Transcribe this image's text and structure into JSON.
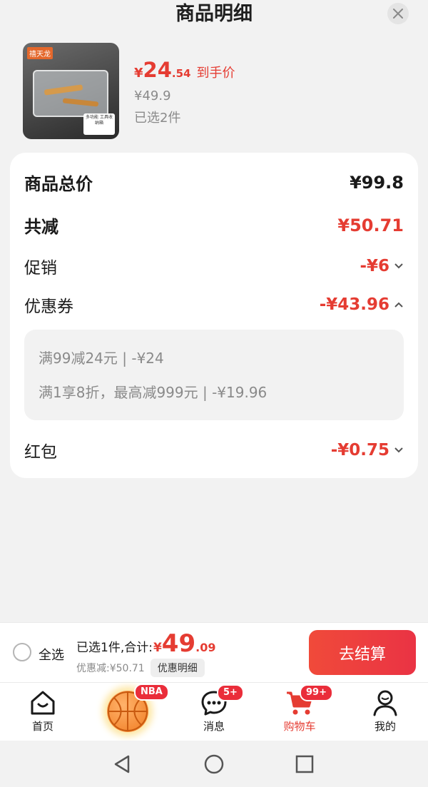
{
  "header": {
    "title": "商品明细"
  },
  "product": {
    "brand_logo": "禧天龙",
    "box_tag": "多功能 工具收纳箱",
    "price_symbol": "¥",
    "price_int": "24",
    "price_dec": ".54",
    "price_label": "到手价",
    "original_price": "¥49.9",
    "selected_count": "已选2件"
  },
  "details": {
    "total_label": "商品总价",
    "total_value": "¥99.8",
    "reduce_label": "共减",
    "reduce_value": "¥50.71",
    "promo_label": "促销",
    "promo_value": "-¥6",
    "coupon_label": "优惠券",
    "coupon_value": "-¥43.96",
    "coupon_items": [
      "满99减24元 | -¥24",
      "满1享8折，最高减999元 | -¥19.96"
    ],
    "redpacket_label": "红包",
    "redpacket_value": "-¥0.75"
  },
  "checkout": {
    "select_all": "全选",
    "sum_label": "已选1件,合计:",
    "sum_symbol": "¥",
    "sum_int": "49",
    "sum_dec": ".09",
    "discount_text": "优惠减:¥50.71",
    "discount_detail": "优惠明细",
    "go_button": "去结算"
  },
  "tabs": [
    {
      "label": "首页",
      "icon": "home-icon"
    },
    {
      "label": "",
      "icon": "basketball-icon",
      "badge": "NBA"
    },
    {
      "label": "消息",
      "icon": "message-icon",
      "badge": "5+"
    },
    {
      "label": "购物车",
      "icon": "cart-icon",
      "badge": "99+"
    },
    {
      "label": "我的",
      "icon": "profile-icon"
    }
  ],
  "colors": {
    "accent": "#e53c32",
    "button": "#ea3344"
  }
}
